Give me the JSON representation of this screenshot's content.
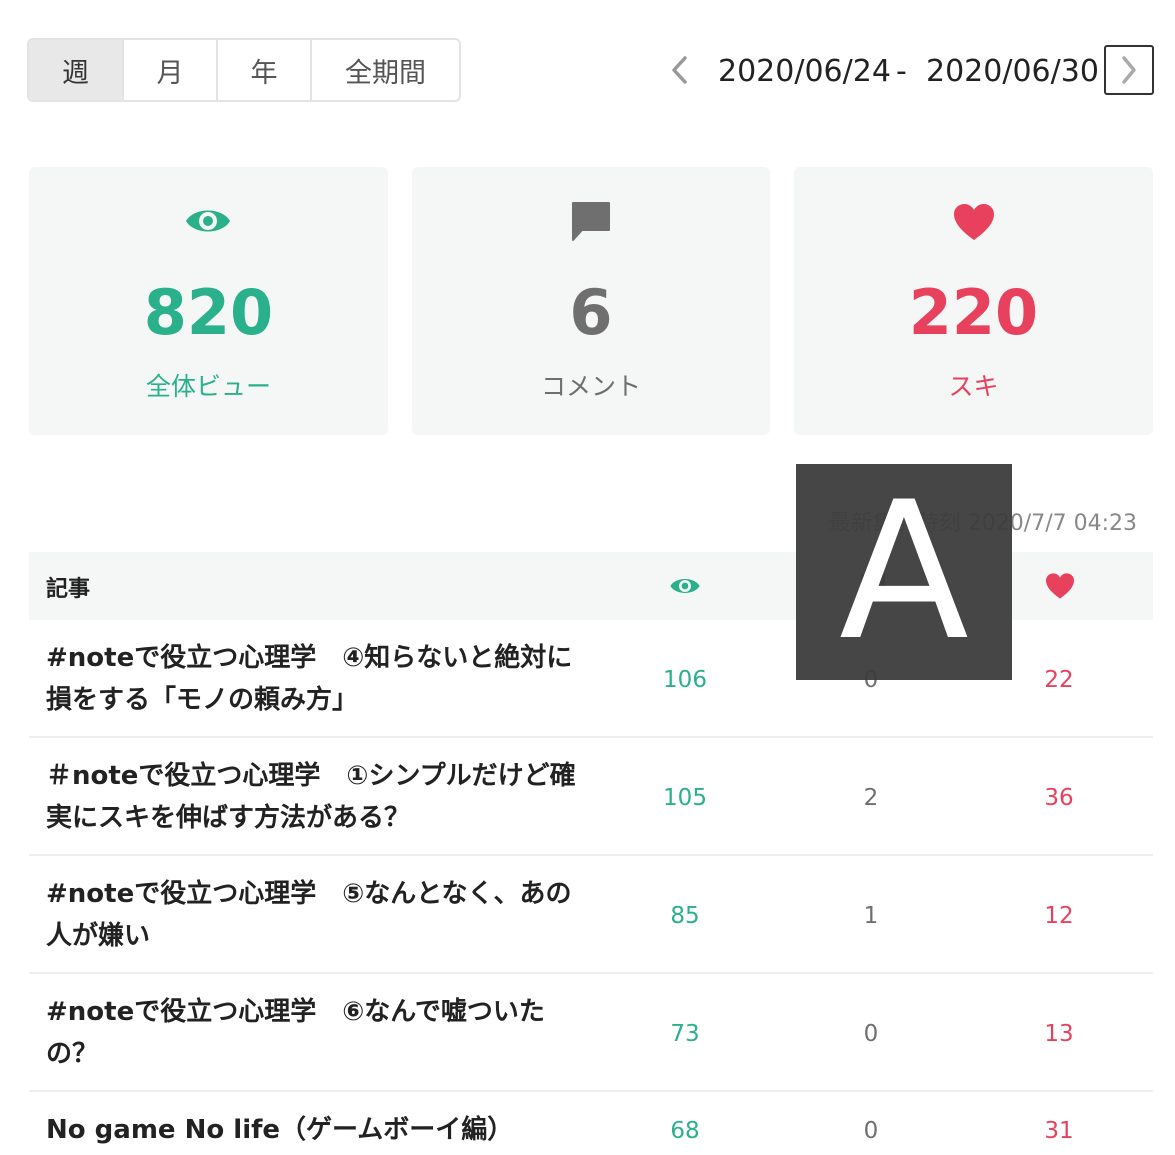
{
  "period_tabs": [
    {
      "label": "週",
      "active": true
    },
    {
      "label": "月",
      "active": false
    },
    {
      "label": "年",
      "active": false
    },
    {
      "label": "全期間",
      "active": false
    }
  ],
  "date_range": {
    "start": "2020/06/24",
    "separator": "-",
    "end": "2020/06/30"
  },
  "summary": {
    "views": {
      "value": "820",
      "label": "全体ビュー",
      "icon": "eye-icon"
    },
    "comments": {
      "value": "6",
      "label": "コメント",
      "icon": "comment-icon"
    },
    "likes": {
      "value": "220",
      "label": "スキ",
      "icon": "heart-icon"
    }
  },
  "updated_at": "最新集計時刻 2020/7/7 04:23",
  "table": {
    "header": {
      "article": "記事"
    },
    "rows": [
      {
        "title": "#noteで役立つ心理学　④知らないと絶対に損をする「モノの頼み方」",
        "views": "106",
        "comments": "0",
        "likes": "22"
      },
      {
        "title": "＃noteで役立つ心理学　①シンプルだけど確実にスキを伸ばす方法がある？",
        "views": "105",
        "comments": "2",
        "likes": "36"
      },
      {
        "title": "#noteで役立つ心理学　⑤なんとなく、あの人が嫌い",
        "views": "85",
        "comments": "1",
        "likes": "12"
      },
      {
        "title": "#noteで役立つ心理学　⑥なんで嘘ついたの？",
        "views": "73",
        "comments": "0",
        "likes": "13"
      },
      {
        "title": "No game No life（ゲームボーイ編）",
        "views": "68",
        "comments": "0",
        "likes": "31"
      }
    ]
  },
  "overlay_marker": "A",
  "colors": {
    "views": "#2bb08c",
    "comments": "#6f6f6f",
    "likes": "#e8415e"
  }
}
